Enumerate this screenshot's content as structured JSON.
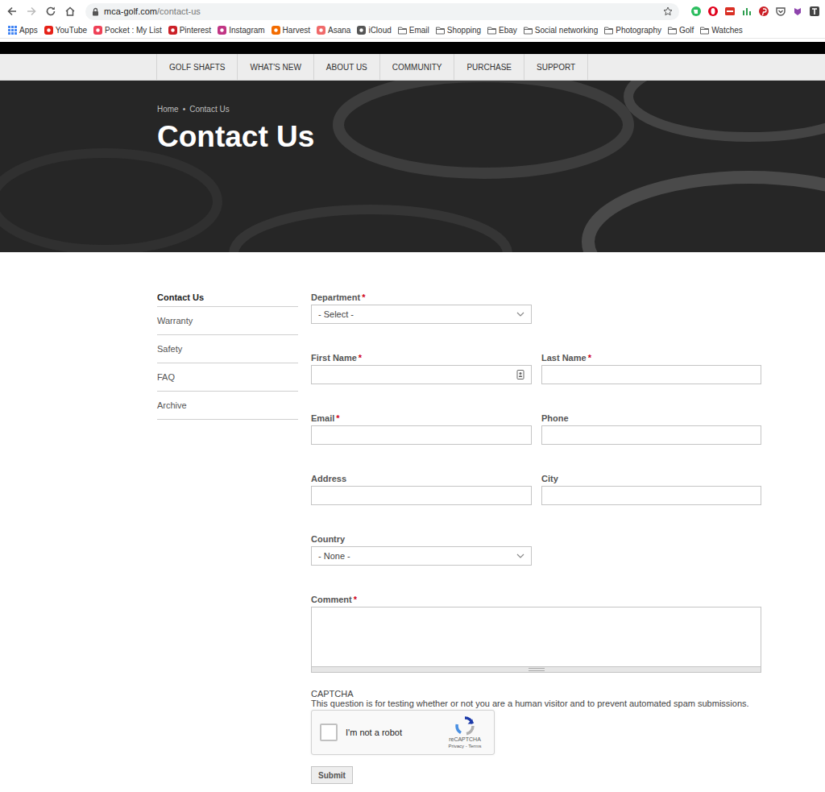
{
  "browser": {
    "url": {
      "host": "mca-golf.com",
      "path": "/contact-us"
    },
    "bookmarks": [
      {
        "label": "Apps",
        "kind": "grid",
        "color": "#4285f4"
      },
      {
        "label": "YouTube",
        "kind": "site",
        "color": "#e62117"
      },
      {
        "label": "Pocket : My List",
        "kind": "site",
        "color": "#ef4056"
      },
      {
        "label": "Pinterest",
        "kind": "site",
        "color": "#cb2027"
      },
      {
        "label": "Instagram",
        "kind": "site",
        "color": "#c13584"
      },
      {
        "label": "Harvest",
        "kind": "site",
        "color": "#f36c00"
      },
      {
        "label": "Asana",
        "kind": "site",
        "color": "#f06a6a"
      },
      {
        "label": "iCloud",
        "kind": "site",
        "color": "#555555"
      },
      {
        "label": "Email",
        "kind": "folder",
        "color": "#666666"
      },
      {
        "label": "Shopping",
        "kind": "folder",
        "color": "#666666"
      },
      {
        "label": "Ebay",
        "kind": "folder",
        "color": "#666666"
      },
      {
        "label": "Social networking",
        "kind": "folder",
        "color": "#666666"
      },
      {
        "label": "Photography",
        "kind": "folder",
        "color": "#666666"
      },
      {
        "label": "Golf",
        "kind": "folder",
        "color": "#666666"
      },
      {
        "label": "Watches",
        "kind": "folder",
        "color": "#666666"
      }
    ]
  },
  "nav": {
    "items": [
      "GOLF SHAFTS",
      "WHAT'S NEW",
      "ABOUT US",
      "COMMUNITY",
      "PURCHASE",
      "SUPPORT"
    ]
  },
  "hero": {
    "breadcrumb": [
      "Home",
      "Contact Us"
    ],
    "separator": "•",
    "title": "Contact Us"
  },
  "sidebar": {
    "items": [
      {
        "label": "Contact Us",
        "selected": true
      },
      {
        "label": "Warranty",
        "selected": false
      },
      {
        "label": "Safety",
        "selected": false
      },
      {
        "label": "FAQ",
        "selected": false
      },
      {
        "label": "Archive",
        "selected": false
      }
    ]
  },
  "form": {
    "required_marker": "*",
    "rows": [
      [
        {
          "label": "Department",
          "required": true,
          "kind": "select",
          "value": "- Select -"
        }
      ],
      [
        {
          "label": "First Name",
          "required": true,
          "kind": "text",
          "autofill": true
        },
        {
          "label": "Last Name",
          "required": true,
          "kind": "text",
          "autofill": false
        }
      ],
      [
        {
          "label": "Email",
          "required": true,
          "kind": "text",
          "autofill": false
        },
        {
          "label": "Phone",
          "required": false,
          "kind": "text",
          "autofill": false
        }
      ],
      [
        {
          "label": "Address",
          "required": false,
          "kind": "text",
          "autofill": false
        },
        {
          "label": "City",
          "required": false,
          "kind": "text",
          "autofill": false
        }
      ],
      [
        {
          "label": "Country",
          "required": false,
          "kind": "select",
          "value": "- None -"
        }
      ],
      [
        {
          "label": "Comment",
          "required": true,
          "kind": "textarea"
        }
      ]
    ]
  },
  "captcha": {
    "title": "CAPTCHA",
    "description": "This question is for testing whether or not you are a human visitor and to prevent automated spam submissions.",
    "checkbox_label": "I'm not a robot",
    "checked": false,
    "brand": "reCAPTCHA",
    "links": "Privacy - Terms"
  },
  "submit": "Submit"
}
